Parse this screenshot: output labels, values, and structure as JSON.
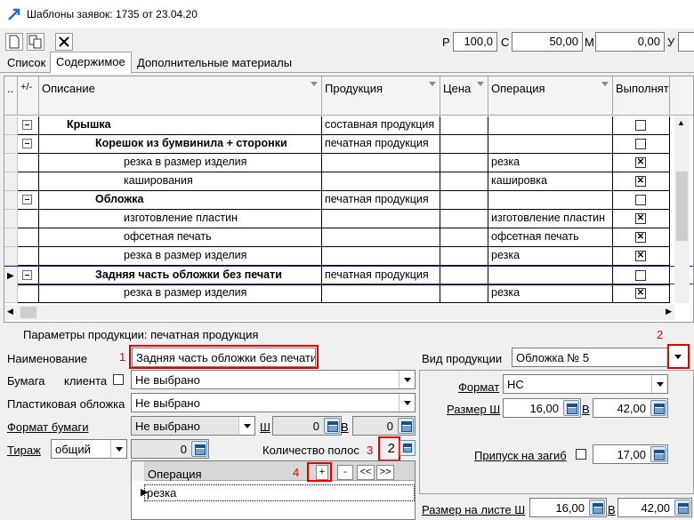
{
  "window": {
    "title": "Шаблоны заявок: 1735 от 23.04.20"
  },
  "toolbar": {
    "p_label": "Р",
    "p_value": "100,0",
    "c_label": "С",
    "c_value": "50,00",
    "m_label": "М",
    "m_value": "0,00",
    "u_label": "У"
  },
  "tabs": [
    {
      "label": "Список"
    },
    {
      "label": "Содержимое"
    },
    {
      "label": "Дополнительные материалы"
    }
  ],
  "grid": {
    "columns": {
      "expand": "+/-",
      "description": "Описание",
      "product": "Продукция",
      "price": "Цена",
      "operation": "Операция",
      "done": "Выполнят"
    },
    "rows": [
      {
        "desc": "Крышка",
        "product": "составная продукция",
        "operation": "",
        "checked": "",
        "level": 1,
        "group": true
      },
      {
        "desc": "Корешок из бумвинила + сторонки",
        "product": "печатная продукция",
        "operation": "",
        "checked": "",
        "level": 2,
        "group": true
      },
      {
        "desc": "резка в размер изделия",
        "product": "",
        "operation": "резка",
        "checked": "✕",
        "level": 3,
        "group": false
      },
      {
        "desc": "каширования",
        "product": "",
        "operation": "кашировка",
        "checked": "✕",
        "level": 3,
        "group": false
      },
      {
        "desc": "Обложка",
        "product": "печатная продукция",
        "operation": "",
        "checked": "",
        "level": 2,
        "group": true
      },
      {
        "desc": "изготовление пластин",
        "product": "",
        "operation": "изготовление пластин",
        "checked": "✕",
        "level": 3,
        "group": false
      },
      {
        "desc": "офсетная печать",
        "product": "",
        "operation": "офсетная печать",
        "checked": "✕",
        "level": 3,
        "group": false
      },
      {
        "desc": "резка в размер изделия",
        "product": "",
        "operation": "резка",
        "checked": "✕",
        "level": 3,
        "group": false
      },
      {
        "desc": "Задняя часть обложки без печати",
        "product": "печатная продукция",
        "operation": "",
        "checked": "",
        "level": 2,
        "group": true,
        "current": true
      },
      {
        "desc": "резка в размер изделия",
        "product": "",
        "operation": "резка",
        "checked": "✕",
        "level": 3,
        "group": false
      }
    ]
  },
  "params": {
    "header": "Параметры продукции: печатная продукция",
    "name_label": "Наименование",
    "name_value": "Задняя часть обложки без печати",
    "name_marker": "1",
    "paper_label": "Бумага",
    "client_label": "клиента",
    "paper_value": "Не выбрано",
    "plastic_label": "Пластиковая обложка",
    "plastic_value": "Не выбрано",
    "paper_format_label": "Формат бумаги",
    "paper_format_value": "Не выбрано",
    "sh_label": "Ш",
    "sh_value": "0",
    "v_label": "В",
    "v_value": "0",
    "tirage_label": "Тираж",
    "tirage_value": "общий",
    "tirage_num": "0",
    "pages_label": "Количество полос",
    "pages_marker": "3",
    "pages_value": "2",
    "product_type_label": "Вид продукции",
    "product_type_value": "Обложка  № 5",
    "product_type_marker": "2",
    "format_label": "Формат",
    "format_value": "НС",
    "size_label": "Размер Ш",
    "size_w": "16,00",
    "size_v_label": "В",
    "size_h": "42,00",
    "fold_label": "Припуск на загиб",
    "fold_value": "17,00",
    "sheet_label": "Размер на листе Ш",
    "sheet_w": "16,00",
    "sheet_v_label": "В",
    "sheet_h": "42,00"
  },
  "operations": {
    "header": "Операция",
    "marker": "4",
    "add": "+",
    "remove": "-",
    "prev": "<<",
    "next": ">>",
    "items": [
      {
        "name": "резка"
      }
    ]
  }
}
